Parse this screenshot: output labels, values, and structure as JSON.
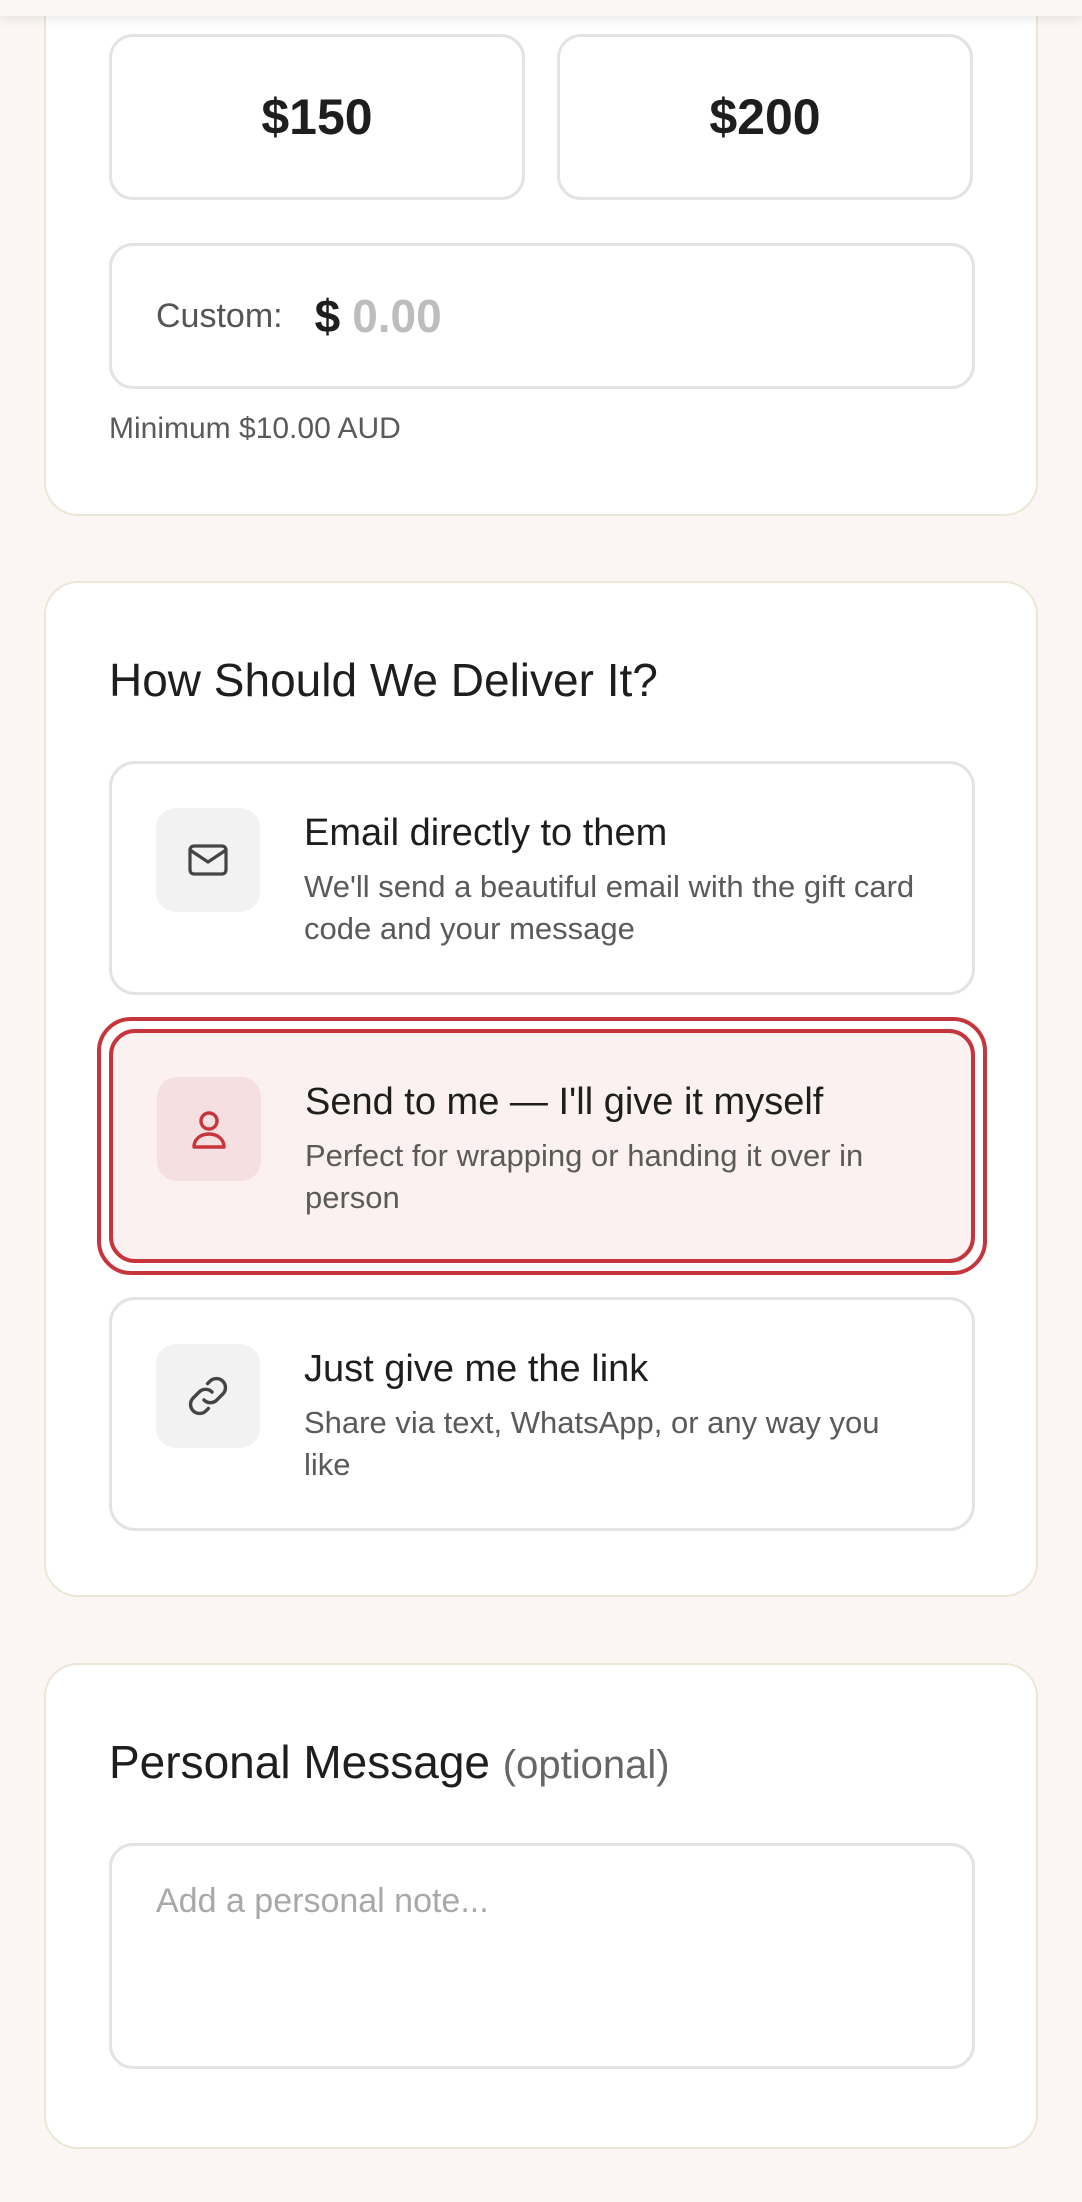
{
  "amounts": {
    "option_150": "$150",
    "option_200": "$200"
  },
  "custom_amount": {
    "label": "Custom:",
    "currency_symbol": "$",
    "value": "",
    "placeholder": "0.00",
    "minimum_note": "Minimum $10.00 AUD"
  },
  "delivery": {
    "title": "How Should We Deliver It?",
    "options": [
      {
        "title": "Email directly to them",
        "description": "We'll send a beautiful email with the gift card code and your message",
        "icon": "mail-icon",
        "selected": false
      },
      {
        "title": "Send to me — I'll give it myself",
        "description": "Perfect for wrapping or handing it over in person",
        "icon": "person-icon",
        "selected": true
      },
      {
        "title": "Just give me the link",
        "description": "Share via text, WhatsApp, or any way you like",
        "icon": "link-icon",
        "selected": false
      }
    ]
  },
  "message": {
    "title": "Personal Message",
    "optional_label": "(optional)",
    "value": "",
    "placeholder": "Add a personal note..."
  },
  "colors": {
    "accent": "#c7353c",
    "selected_bg": "#fbf1f1",
    "card_border": "#ebe7d6",
    "page_bg": "#fbf6f4"
  }
}
